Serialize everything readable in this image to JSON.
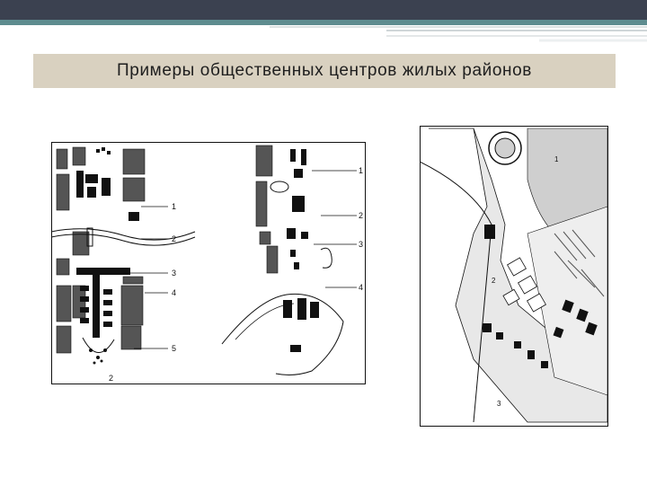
{
  "slide": {
    "title": "Примеры общественных центров жилых районов"
  },
  "figure_left": {
    "plan_a_callouts": [
      "1",
      "2",
      "3",
      "4",
      "5"
    ],
    "plan_a_caption": "2",
    "plan_b_callouts": [
      "1",
      "2",
      "3",
      "4"
    ]
  },
  "figure_right": {
    "labels": [
      "1",
      "2",
      "3"
    ]
  },
  "colors": {
    "header_dark": "#3b4150",
    "header_teal": "#5e8c8f",
    "title_band": "#d9d1c0",
    "ink": "#111111"
  }
}
